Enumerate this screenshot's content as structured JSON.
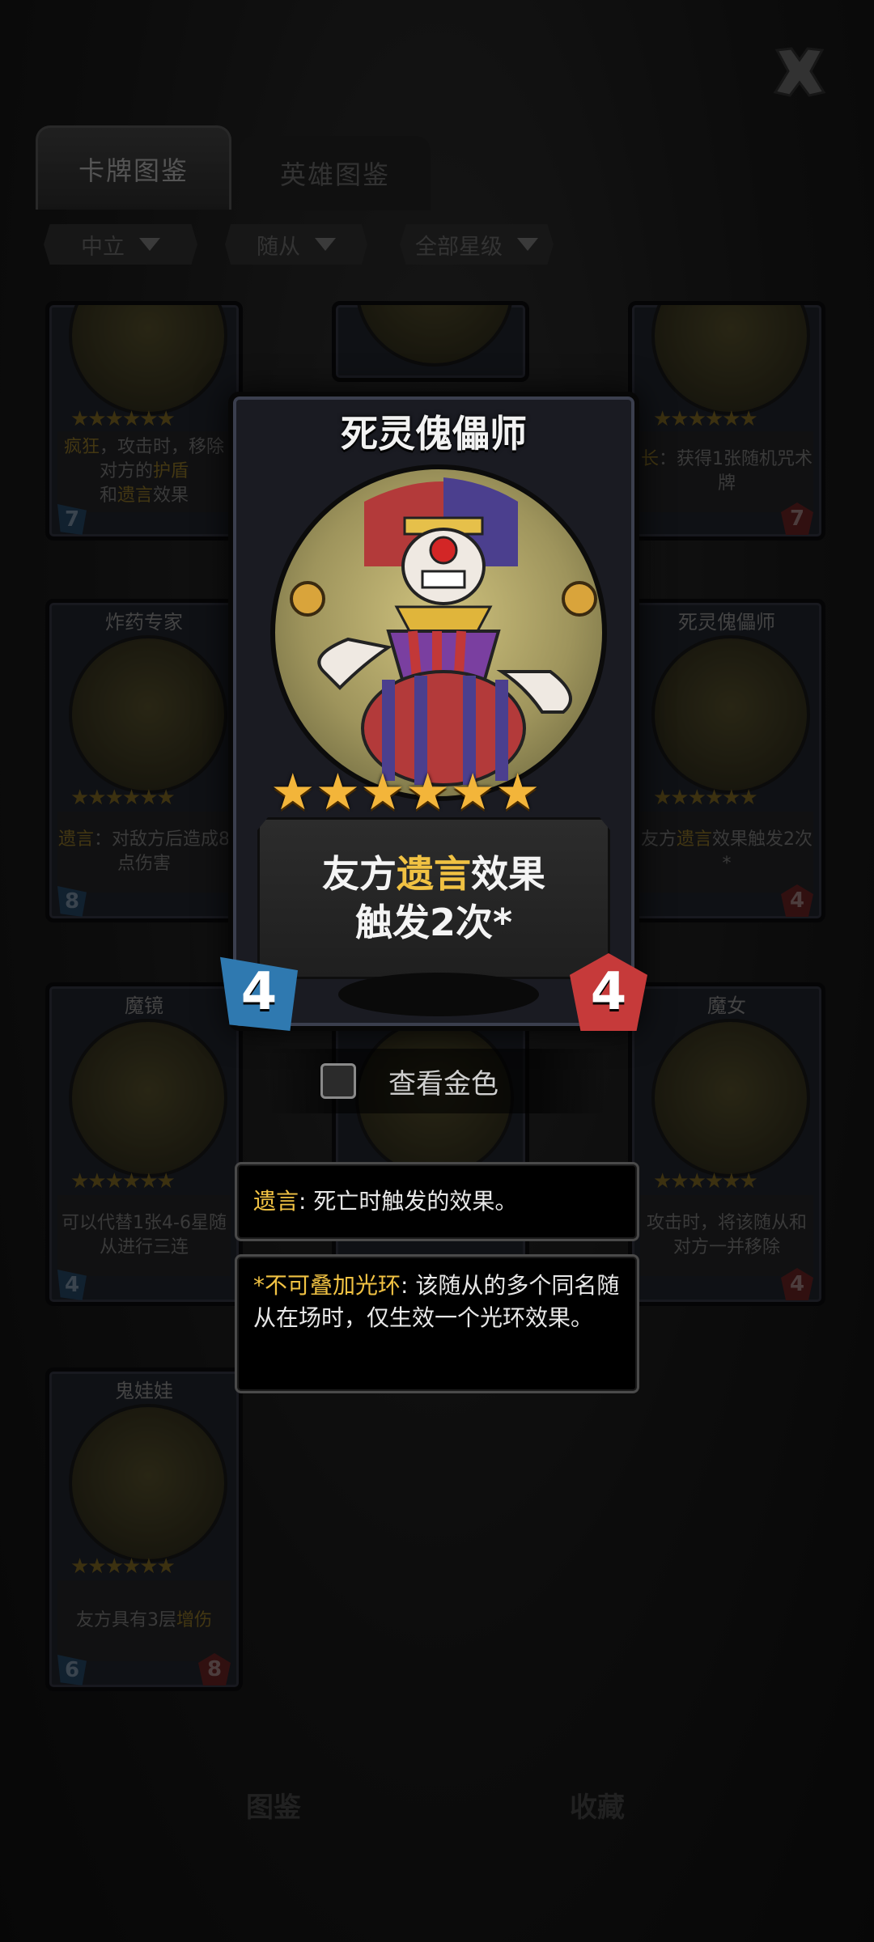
{
  "tabs": {
    "cards": "卡牌图鉴",
    "heroes": "英雄图鉴"
  },
  "filters": {
    "faction": "中立",
    "type": "随从",
    "rarity": "全部星级"
  },
  "bg_cards": [
    {
      "name": "",
      "desc_parts": [
        "疯狂",
        "，攻击时，移除对方的",
        "护盾",
        "和",
        "遗言",
        "效果"
      ],
      "cost": "7",
      "hp": ""
    },
    {
      "name": "",
      "desc_parts": [
        "",
        "",
        "",
        "",
        "",
        ""
      ],
      "cost": "",
      "hp": ""
    },
    {
      "name": "",
      "desc_parts": [
        "长",
        "：获得1张随机咒术牌",
        "",
        "",
        "",
        ""
      ],
      "cost": "",
      "hp": "7"
    },
    {
      "name": "炸药专家",
      "desc_parts": [
        "遗言",
        "：对敌方后造成8点伤害",
        "",
        "",
        "",
        ""
      ],
      "cost": "8",
      "hp": ""
    },
    {
      "name": "死灵傀儡师",
      "desc_parts": [
        "友方",
        "遗言",
        "效果触发2次*",
        "",
        "",
        ""
      ],
      "cost": "",
      "hp": "4"
    },
    {
      "name": "魔镜",
      "desc_parts": [
        "可以代替1张4-6星随从进行三连",
        "",
        "",
        "",
        "",
        ""
      ],
      "cost": "4",
      "hp": ""
    },
    {
      "name": "魔女",
      "desc_parts": [
        "攻击时，将该随从和对方一并移除",
        "",
        "",
        "",
        "",
        ""
      ],
      "cost": "",
      "hp": "4"
    },
    {
      "name": "鬼娃娃",
      "desc_parts": [
        "友方具有3层",
        "增伤",
        "",
        "",
        "",
        ""
      ],
      "cost": "6",
      "hp": "8"
    }
  ],
  "bottom_nav": {
    "encyclopedia": "图鉴",
    "collection": "收藏"
  },
  "detail_card": {
    "name": "死灵傀儡师",
    "stars": 6,
    "star_glyphs": "★★★★★★",
    "desc_line1_a": "友方",
    "desc_line1_kw": "遗言",
    "desc_line1_b": "效果",
    "desc_line2": "触发2次*",
    "cost": "4",
    "hp": "4"
  },
  "gold_toggle": {
    "label": "查看金色",
    "checked": false
  },
  "tooltips": {
    "deathrattle_kw": "遗言",
    "deathrattle_text": ": 死亡时触发的效果。",
    "aura_kw": "*不可叠加光环",
    "aura_text": ": 该随从的多个同名随从在场时，仅生效一个光环效果。"
  },
  "colors": {
    "keyword": "#f1c243",
    "cost": "#2f79b0",
    "hp": "#c63a3a",
    "star": "#f3b53a"
  }
}
